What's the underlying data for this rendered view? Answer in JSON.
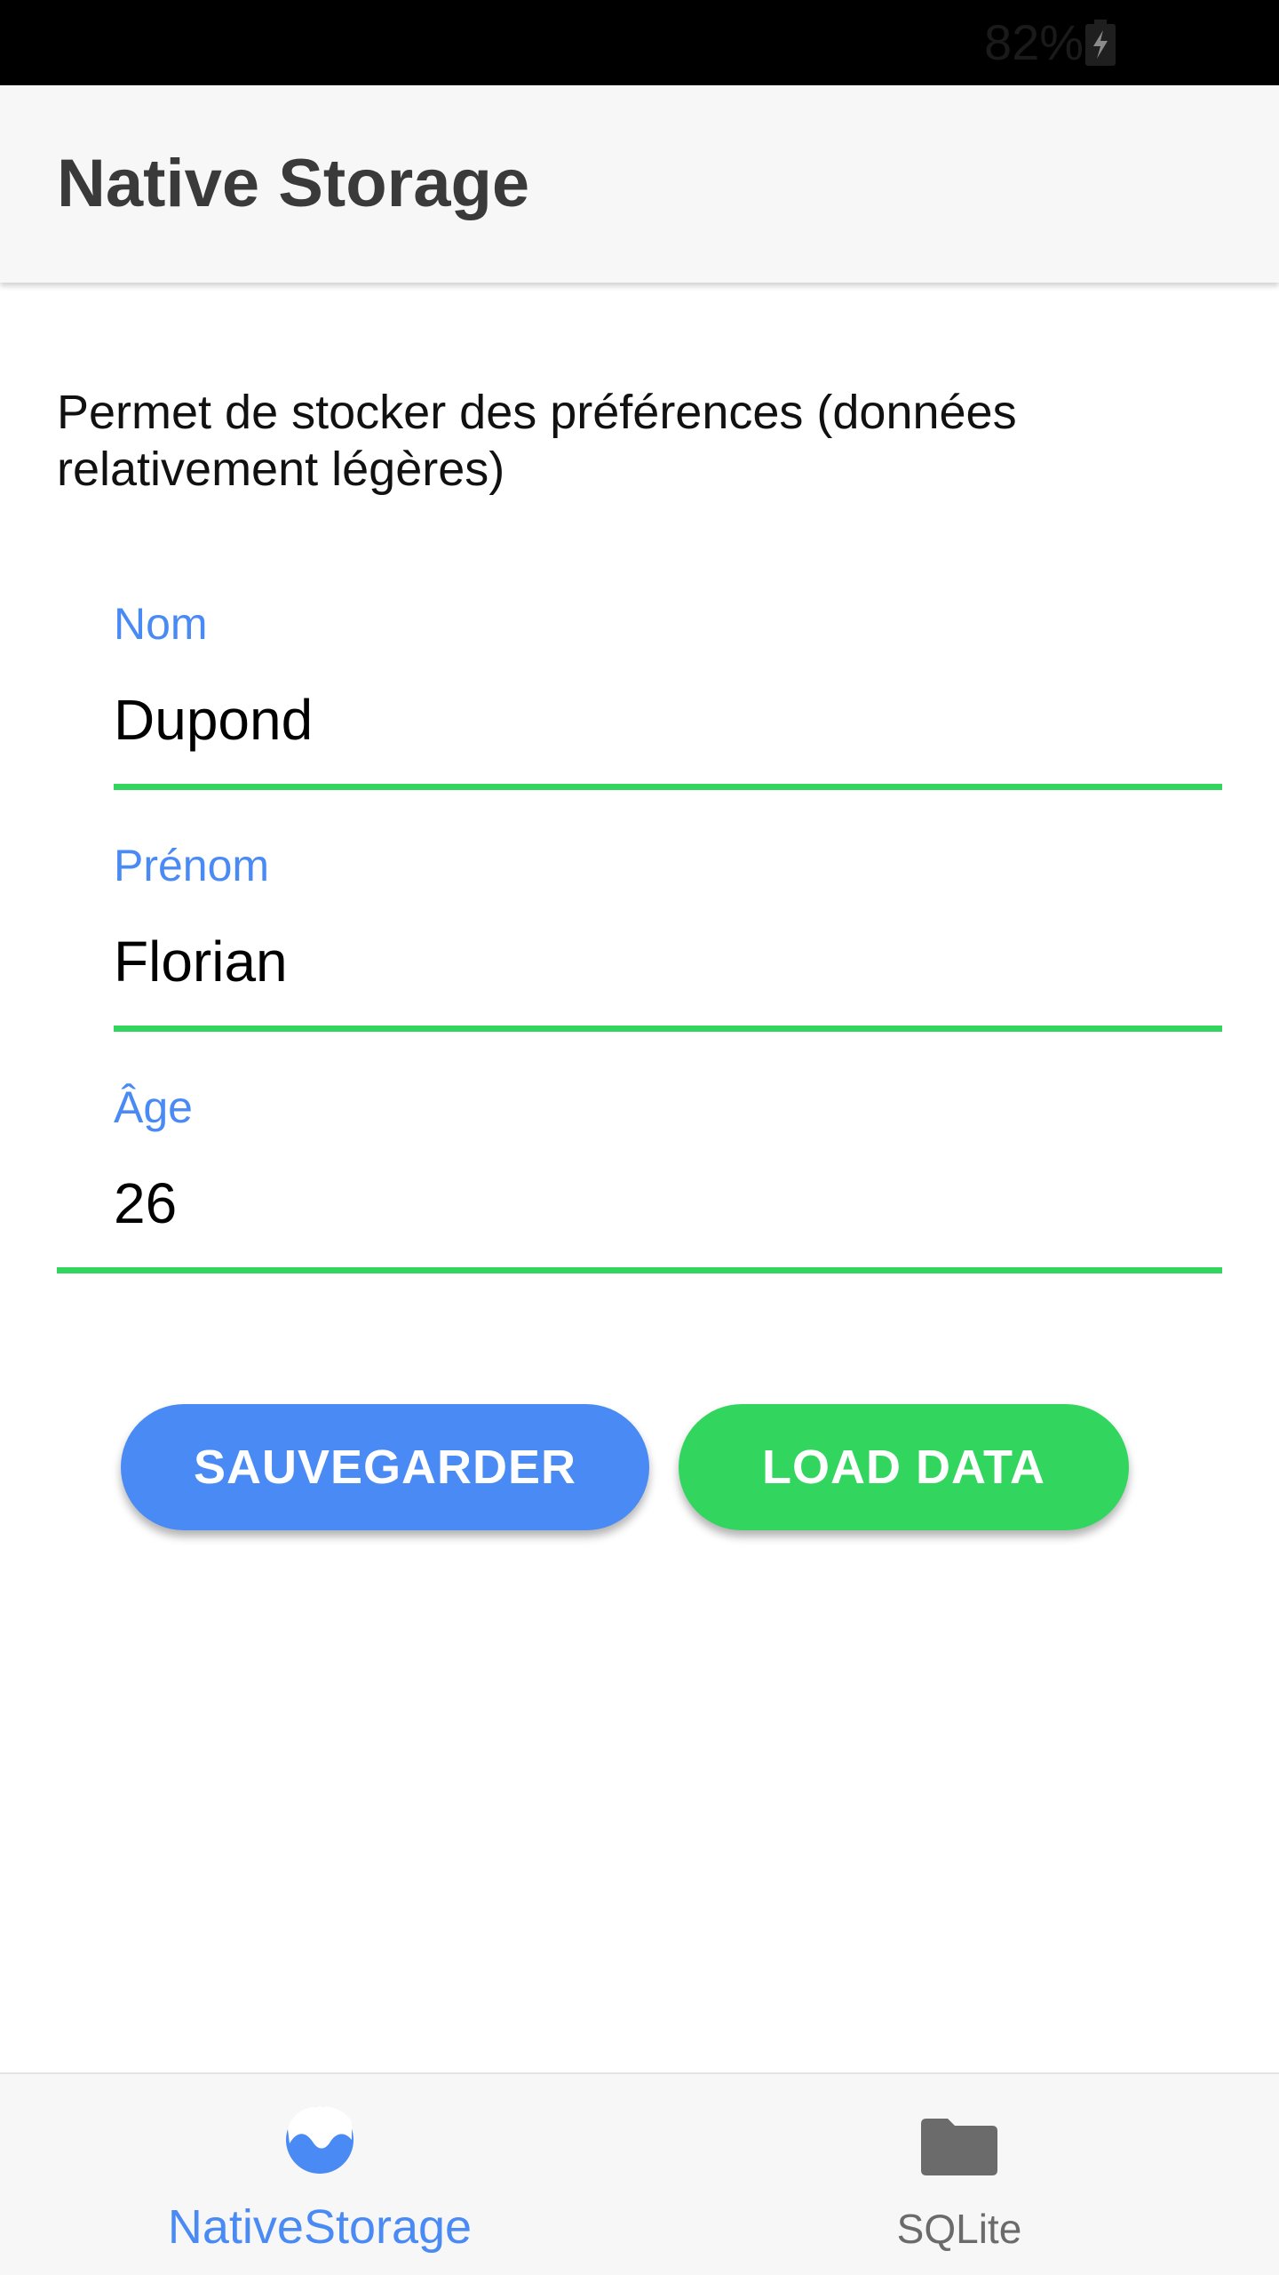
{
  "status_bar": {
    "battery_percent": "82%",
    "battery_icon": "battery-charging-icon"
  },
  "header": {
    "title": "Native Storage"
  },
  "content": {
    "description": "Permet de stocker des préférences (données relativement légères)",
    "fields": [
      {
        "label": "Nom",
        "value": "Dupond"
      },
      {
        "label": "Prénom",
        "value": "Florian"
      },
      {
        "label": "Âge",
        "value": "26"
      }
    ],
    "underline_color": "#32d65f",
    "label_color": "#4a8af4"
  },
  "buttons": {
    "save_label": "SAUVEGARDER",
    "save_color": "#4a8af4",
    "load_label": "LOAD DATA",
    "load_color": "#32d65f"
  },
  "tabbar": {
    "tabs": [
      {
        "label": "NativeStorage",
        "icon": "water-wave-icon",
        "active": true
      },
      {
        "label": "SQLite",
        "icon": "folder-icon",
        "active": false
      }
    ],
    "active_color": "#4a8af4",
    "inactive_color": "#6b6b6b"
  }
}
